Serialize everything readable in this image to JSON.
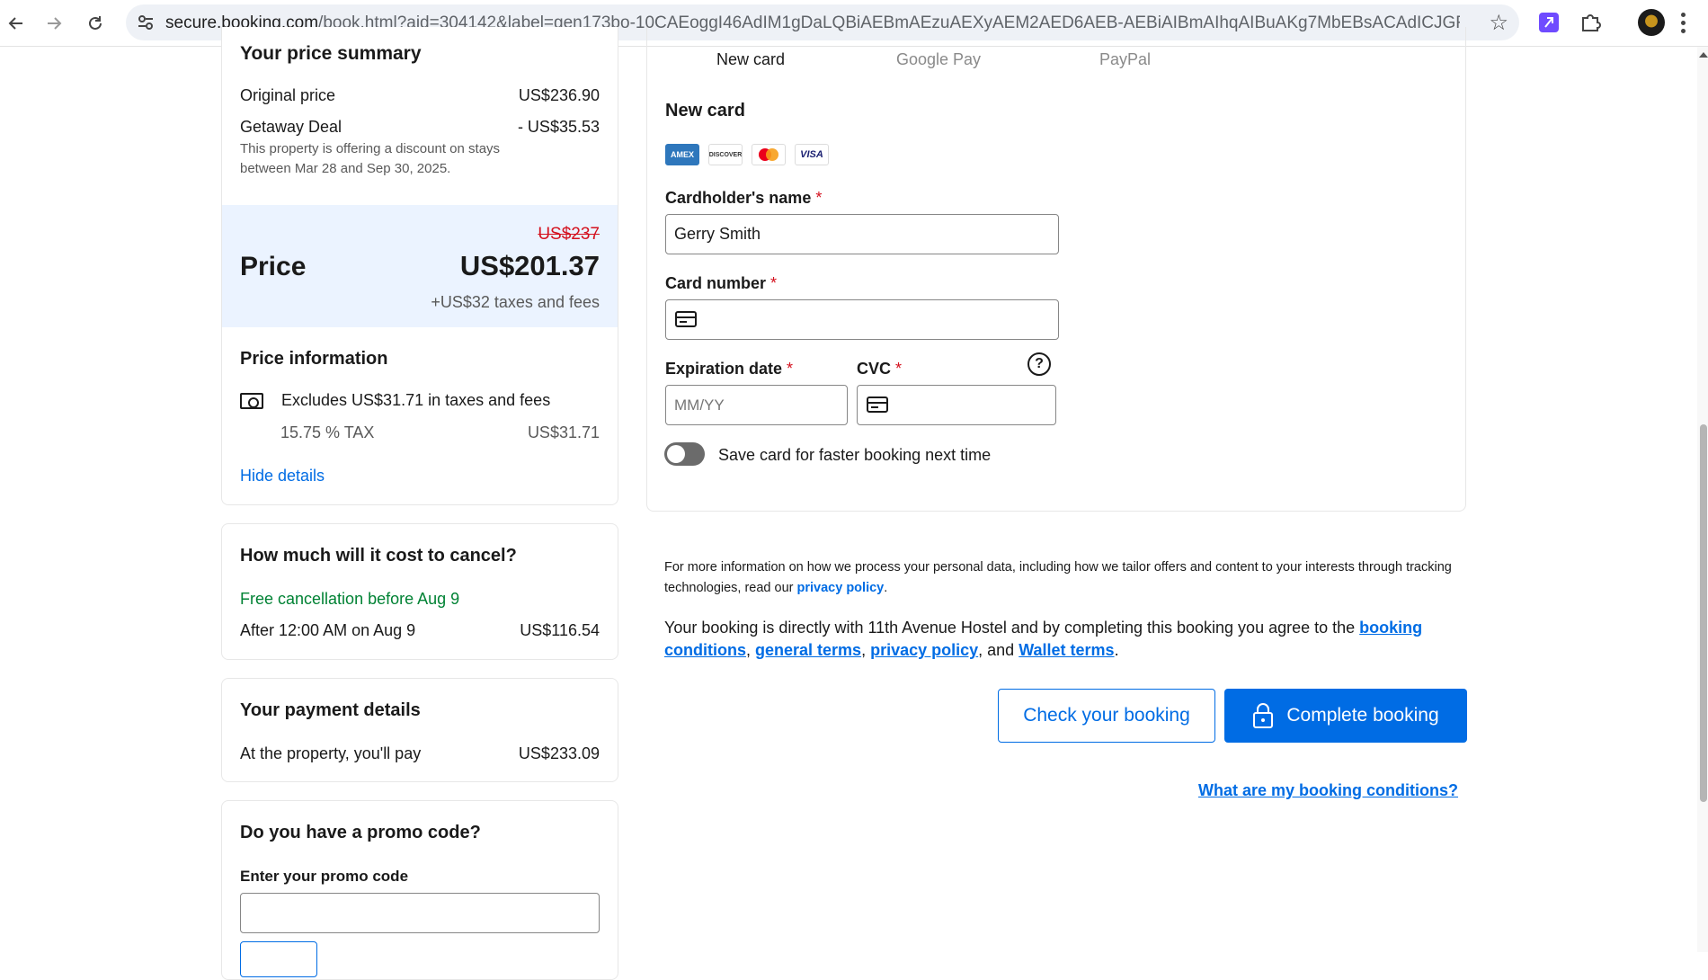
{
  "browser": {
    "url_domain": "secure.booking.com",
    "url_path": "/book.html?aid=304142&label=gen173bo-10CAEoggI46AdIM1gDaLQBiAEBmAEzuAEXyAEM2AED6AEB-AEBiAIBmAIhqAIBuAKg7MbEBsACAdICJGRmMzg5NWJlLWYw..."
  },
  "price_summary": {
    "title": "Your price summary",
    "original_label": "Original price",
    "original_value": "US$236.90",
    "deal_label": "Getaway Deal",
    "deal_value": "- US$35.53",
    "deal_note": "This property is offering a discount on stays between Mar 28 and Sep 30, 2025.",
    "price_old": "US$237",
    "price_label": "Price",
    "price_value": "US$201.37",
    "taxes_note": "+US$32 taxes and fees",
    "info_title": "Price information",
    "excludes_text": "Excludes US$31.71 in taxes and fees",
    "tax_label": "15.75 % TAX",
    "tax_value": "US$31.71",
    "hide_details": "Hide details"
  },
  "cancel": {
    "title": "How much will it cost to cancel?",
    "free_text": "Free cancellation before Aug 9",
    "after_label": "After 12:00 AM on Aug 9",
    "after_value": "US$116.54"
  },
  "payment_details": {
    "title": "Your payment details",
    "label": "At the property, you'll pay",
    "value": "US$233.09"
  },
  "promo": {
    "title": "Do you have a promo code?",
    "input_label": "Enter your promo code",
    "input_value": ""
  },
  "payment_form": {
    "tabs": [
      "New card",
      "Google Pay",
      "PayPal"
    ],
    "section_title": "New card",
    "card_brands": [
      "AMEX",
      "DISCOVER",
      "mastercard",
      "VISA"
    ],
    "name_label": "Cardholder's name",
    "name_value": "Gerry Smith",
    "number_label": "Card number",
    "number_value": "",
    "exp_label": "Expiration date",
    "exp_placeholder": "MM/YY",
    "cvc_label": "CVC",
    "cvc_value": "",
    "required_mark": "*",
    "help_glyph": "?",
    "save_card_label": "Save card for faster booking next time",
    "save_card_on": false
  },
  "legal": {
    "privacy_text": "For more information on how we process your personal data, including how we tailor offers and content to your interests through tracking technologies, read our ",
    "privacy_link": "privacy policy",
    "privacy_end": ".",
    "agreement_text": "Your booking is directly with 11th Avenue Hostel and by completing this booking you agree to the ",
    "booking_conditions": "booking conditions",
    "sep1": ", ",
    "general_terms": "general terms",
    "sep2": ", ",
    "privacy_policy": "privacy policy",
    "sep3": ", and ",
    "wallet_terms": "Wallet terms",
    "end": "."
  },
  "actions": {
    "check_booking": "Check your booking",
    "complete_booking": "Complete booking",
    "conditions_link": "What are my booking conditions?"
  },
  "colors": {
    "brand_blue": "#006ce4",
    "price_band": "#ebf3ff",
    "strike_red": "#d4111e",
    "free_green": "#008234"
  },
  "icons": [
    "back-arrow-icon",
    "forward-arrow-icon",
    "reload-icon",
    "site-settings-icon",
    "star-icon",
    "extension-icon",
    "puzzle-icon",
    "profile-avatar",
    "more-menu-icon",
    "money-icon",
    "card-icon",
    "help-icon",
    "lock-icon"
  ]
}
